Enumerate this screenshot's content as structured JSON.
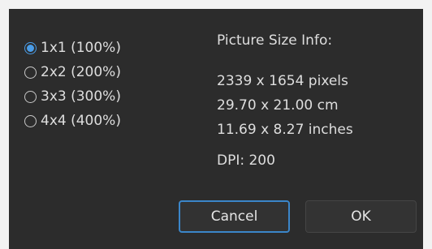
{
  "options": [
    {
      "label": "1x1 (100%)",
      "checked": true
    },
    {
      "label": "2x2 (200%)",
      "checked": false
    },
    {
      "label": "3x3 (300%)",
      "checked": false
    },
    {
      "label": "4x4 (400%)",
      "checked": false
    }
  ],
  "info": {
    "heading": "Picture Size Info:",
    "pixels": "2339 x 1654 pixels",
    "cm": "29.70 x 21.00 cm",
    "inches": "11.69 x 8.27 inches",
    "dpi": "DPI: 200"
  },
  "buttons": {
    "cancel": "Cancel",
    "ok": "OK"
  },
  "colors": {
    "background": "#2c2c2c",
    "accent": "#4a9de8",
    "text": "#dedede"
  }
}
